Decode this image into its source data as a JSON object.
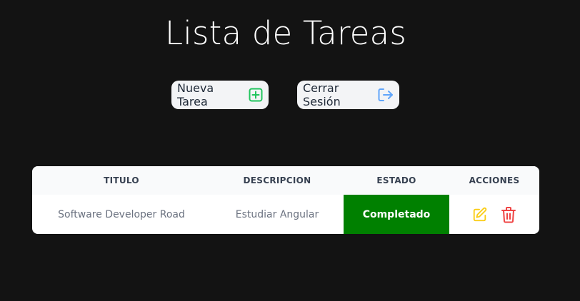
{
  "header": {
    "title": "Lista de Tareas"
  },
  "toolbar": {
    "new_task_label": "Nueva Tarea",
    "new_task_icon": "plus-square-icon",
    "logout_label": "Cerrar Sesión",
    "logout_icon": "logout-arrow-icon"
  },
  "table": {
    "columns": [
      "TITULO",
      "DESCRIPCION",
      "ESTADO",
      "ACCIONES"
    ],
    "rows": [
      {
        "titulo": "Software Developer Road",
        "descripcion": "Estudiar Angular",
        "estado": "Completado",
        "actions": [
          "edit-icon",
          "trash-icon"
        ]
      }
    ]
  },
  "colors": {
    "background": "#131313",
    "status_completed": "#008000",
    "new_task_icon": "#22c55e",
    "logout_icon": "#60a5fa",
    "edit_icon": "#facc15",
    "delete_icon": "#ef4444"
  }
}
